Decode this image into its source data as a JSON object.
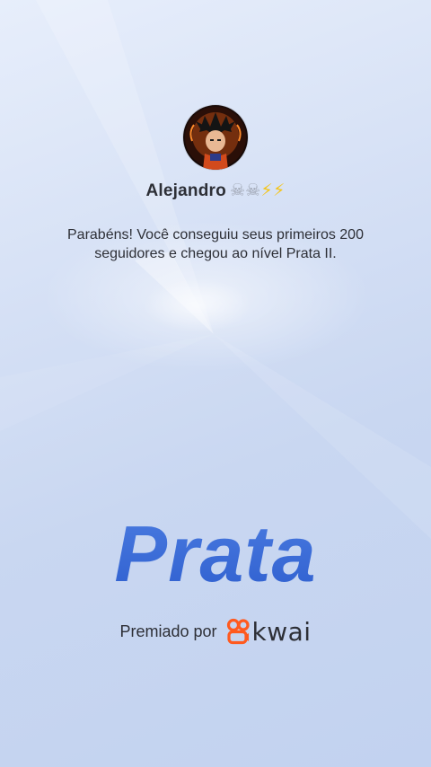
{
  "user": {
    "name": "Alejandro",
    "name_emojis": [
      "☠",
      "☠",
      "⚡",
      "⚡"
    ]
  },
  "message": "Parabéns! Você conseguiu seus primeiros 200 seguidores e chegou ao nível Prata II.",
  "tier": {
    "title": "Prata"
  },
  "award": {
    "label": "Premiado por",
    "brand": "kwai"
  },
  "colors": {
    "tier_text": "#3d68d3",
    "brand_logo": "#ff5a1f",
    "text": "#2d2f36"
  }
}
